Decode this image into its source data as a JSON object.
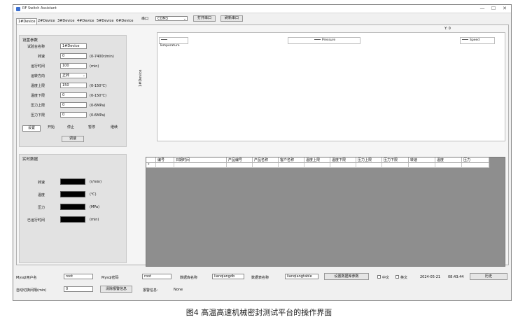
{
  "window": {
    "title": "RF Switch Assistant",
    "controls": [
      "—",
      "☐",
      "✕"
    ]
  },
  "tabs": [
    "1#Device",
    "2#Device",
    "3#Device",
    "4#Device",
    "5#Device",
    "6#Device"
  ],
  "port": {
    "label": "串口",
    "value": "COM3",
    "open_label": "打开串口",
    "refresh_label": "刷新串口"
  },
  "settings": {
    "title": "设置参数",
    "rows": [
      {
        "label": "试验台名称",
        "value": "1#Device",
        "unit": ""
      },
      {
        "label": "转速",
        "value": "0",
        "unit": "(0-7400r/min)"
      },
      {
        "label": "运行时间",
        "value": "100",
        "unit": "(min)"
      },
      {
        "label": "运转方向",
        "value": "正转",
        "unit": ""
      },
      {
        "label": "温度上限",
        "value": "150",
        "unit": "(0-150℃)"
      },
      {
        "label": "温度下限",
        "value": "0",
        "unit": "(0-150℃)"
      },
      {
        "label": "压力上限",
        "value": "0",
        "unit": "(0-6MPa)"
      },
      {
        "label": "压力下限",
        "value": "0",
        "unit": "(0-6MPa)"
      }
    ],
    "buttons": [
      "设置",
      "开始",
      "停止",
      "暂停",
      "继续"
    ],
    "debug_label": "调速"
  },
  "realtime": {
    "title": "实时数据",
    "rows": [
      {
        "label": "转速",
        "unit": "(r/min)"
      },
      {
        "label": "温度",
        "unit": "(℃)"
      },
      {
        "label": "压力",
        "unit": "(MPa)"
      },
      {
        "label": "已运行时间",
        "unit": "(min)"
      }
    ]
  },
  "chart": {
    "y_readout": "Y: 0",
    "side_label": "1#Device",
    "legend": [
      "Temperature",
      "Pressure",
      "Speed"
    ]
  },
  "grid": {
    "columns": [
      "编号",
      "日期时间",
      "产品编号",
      "产品名称",
      "客户名称",
      "温度上限",
      "温度下限",
      "压力上限",
      "压力下限",
      "转速",
      "温度",
      "压力"
    ],
    "new_row_marker": "*"
  },
  "bottom": {
    "mysql_user_label": "Mysql用户名",
    "mysql_user_value": "root",
    "mysql_pwd_label": "Mysql密码",
    "mysql_pwd_value": "root",
    "db_name_label": "数据库名称",
    "db_name_value": "lianqiangdb",
    "table_name_label": "数据表名称",
    "table_name_value": "lianqiangtable",
    "set_db_button": "设置数据库参数",
    "lang_cn": "中文",
    "lang_en": "英文",
    "date": "2024-05-21",
    "time": "08:43:44",
    "history_button": "历史",
    "auto_switch_label": "自动切换间隔(min)",
    "auto_switch_value": "0",
    "clear_alarm_button": "清除报警信息",
    "alarm_label": "报警信息:",
    "alarm_value": "None"
  },
  "caption": "图4  高温高速机械密封测试平台的操作界面"
}
